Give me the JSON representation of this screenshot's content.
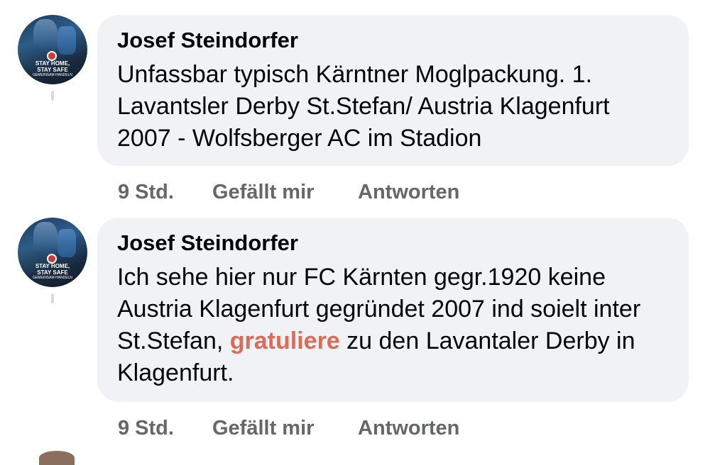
{
  "comments": [
    {
      "avatar_text": [
        "STAY HOME,",
        "STAY SAFE",
        "GEMEINSAM HANDELN"
      ],
      "author": "Josef Steindorfer",
      "text_parts": [
        "Unfassbar typisch Kärntner Moglpackung. 1. Lavantsler Derby St.Stefan/ Austria Klagenfurt 2007 - Wolfsberger AC im Stadion"
      ],
      "time": "9 Std.",
      "like_label": "Gefällt mir",
      "reply_label": "Antworten"
    },
    {
      "avatar_text": [
        "STAY HOME,",
        "STAY SAFE",
        "GEMEINSAM HANDELN"
      ],
      "author": "Josef Steindorfer",
      "text_before": "Ich sehe hier nur FC Kärnten gegr.1920 keine Austria Klagenfurt gegründet 2007 ind soielt inter St.Stefan, ",
      "text_highlight": "gratuliere",
      "text_after": " zu den Lavantaler Derby in Klagenfurt.",
      "time": "9 Std.",
      "like_label": "Gefällt mir",
      "reply_label": "Antworten"
    }
  ],
  "colors": {
    "bubble_bg": "#f0f2f5",
    "text": "#050505",
    "meta": "#65676b",
    "highlight": "#e26a55"
  }
}
